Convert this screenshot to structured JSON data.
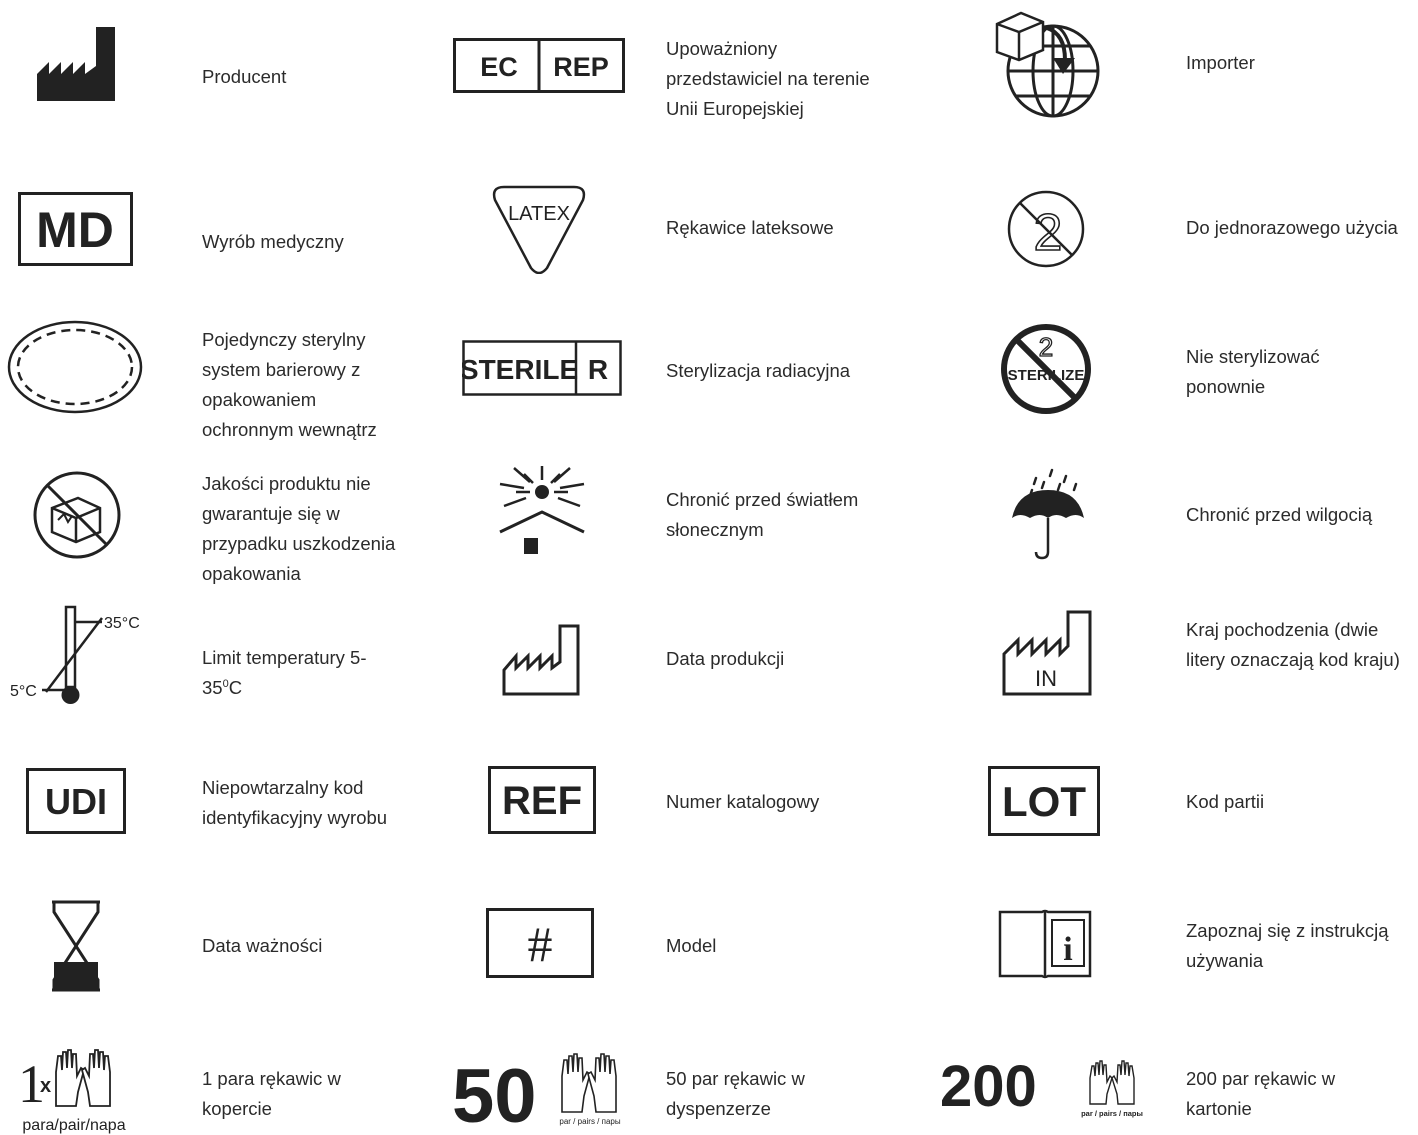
{
  "labels": {
    "manufacturer": "Producent",
    "ec_rep": "Upoważniony przedstawiciel na terenie Unii Europejskiej",
    "importer": "Importer",
    "medical_device": "Wyrób medyczny",
    "latex": "Rękawice lateksowe",
    "single_use": "Do jednorazowego użycia",
    "sterile_barrier": " Pojedynczy sterylny system barierowy z opakowaniem ochronnym wewnątrz",
    "sterile_r": "Sterylizacja radiacyjna",
    "no_resterilize": "Nie sterylizować ponownie",
    "damaged_package": "Jakości produktu nie gwarantuje się w przypadku uszkodzenia opakowania",
    "sunlight": "Chronić przed światłem słonecznym",
    "moisture": "Chronić przed wilgocią",
    "temp_limit_prefix": "Limit temperatury 5-35",
    "temp_limit_sup": "0",
    "temp_limit_suffix": "C",
    "production_date": "Data produkcji",
    "country_origin": "Kraj pochodzenia (dwie litery oznaczają kod kraju)",
    "udi": "Niepowtarzalny kod identyfikacyjny wyrobu",
    "ref": "Numer katalogowy",
    "lot": "Kod partii",
    "expiry": "Data ważności",
    "model": "Model",
    "ifu": "Zapoznaj się z instrukcją używania",
    "pair_1": "1 para rękawic w kopercie",
    "pair_50": "50 par rękawic w dyspenzerze",
    "pair_200": "200 par rękawic w kartonie"
  },
  "icon_text": {
    "ec": "EC",
    "rep": "REP",
    "md": "MD",
    "latex": "LATEX",
    "sterile": "STERILE",
    "r": "R",
    "two": "2",
    "sterilize": "STERILIZE",
    "temp_high": "35°C",
    "temp_low": "5°C",
    "country_code": "IN",
    "udi": "UDI",
    "ref": "REF",
    "lot": "LOT",
    "hash": "#",
    "info": "i",
    "one": "1",
    "x": "x",
    "para_pair": "para/pair/napa",
    "fifty": "50",
    "two_hundred": "200",
    "par_pairs": "par / pairs / пары"
  }
}
